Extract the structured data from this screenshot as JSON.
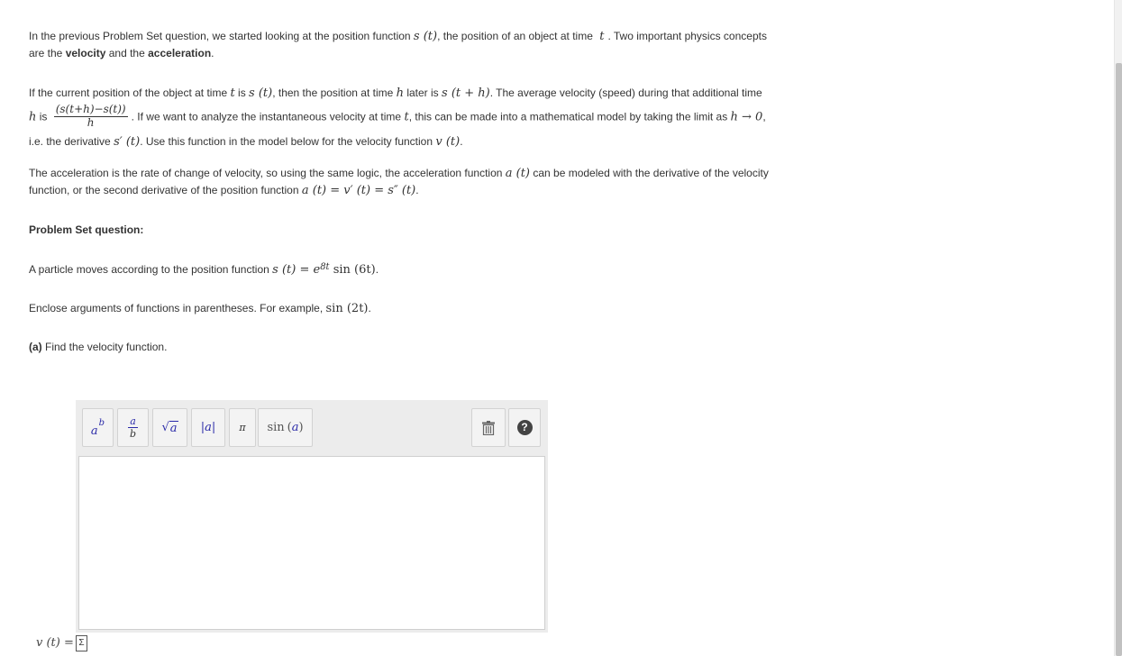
{
  "intro": {
    "text1": "In the previous Problem Set question, we started looking at the position function ",
    "s_t": "s (t)",
    "text2": ", the position of an object at time ",
    "t": "t",
    "text3": ". Two important physics concepts are the ",
    "velocity": "velocity",
    "text4": " and the ",
    "acceleration": "acceleration",
    "text5": "."
  },
  "para2": {
    "a": "If the current position of the object at time ",
    "t": "t",
    "b": " is ",
    "s_t": "s (t)",
    "c": ", then the position at time ",
    "h": "h",
    "d": " later is ",
    "s_th": "s (t + h)",
    "e": ". The average velocity (speed) during that additional time ",
    "h2": "h",
    "f": " is ",
    "frac_num": "(s(t+h)−s(t))",
    "frac_den": "h",
    "g": ". If we want to analyze the instantaneous velocity at time ",
    "t2": "t",
    "h_txt": ", this can be made into a mathematical model by taking the limit as ",
    "lim": "h → 0",
    "i": ", i.e. the derivative ",
    "sprime": "s′ (t)",
    "j": ". Use this function in the model below for the velocity function ",
    "v_t": "v (t)",
    "k": "."
  },
  "para3": {
    "a": "The acceleration is the rate of change of velocity, so using the same logic, the acceleration function ",
    "a_t": "a (t)",
    "b": " can be modeled with the derivative of the velocity function, or the second derivative of the position function ",
    "eq": "a (t) = v′ (t) = s″ (t)",
    "c": "."
  },
  "problem_heading": "Problem Set question:",
  "para4": {
    "a": "A particle moves according to the position function ",
    "lhs": "s (t) = e",
    "exp": "8t",
    "rhs": " sin (6t)",
    "c": "."
  },
  "para5": {
    "a": "Enclose arguments of functions in parentheses. For example, ",
    "ex": "sin (2t)",
    "b": "."
  },
  "part_a": {
    "label": "(a)",
    "text": " Find the velocity function."
  },
  "toolbar": {
    "power_base": "a",
    "power_exp": "b",
    "frac_num": "a",
    "frac_den": "b",
    "sqrt_arg": "a",
    "abs": "|a|",
    "pi": "π",
    "sin_fn": "sin",
    "sin_arg": "a",
    "help": "?"
  },
  "answer": {
    "label": "v (t) =",
    "symbol": "Σ"
  },
  "colors": {
    "toolbar_icon": "#2a2aa8",
    "editor_bg": "#ececec"
  }
}
